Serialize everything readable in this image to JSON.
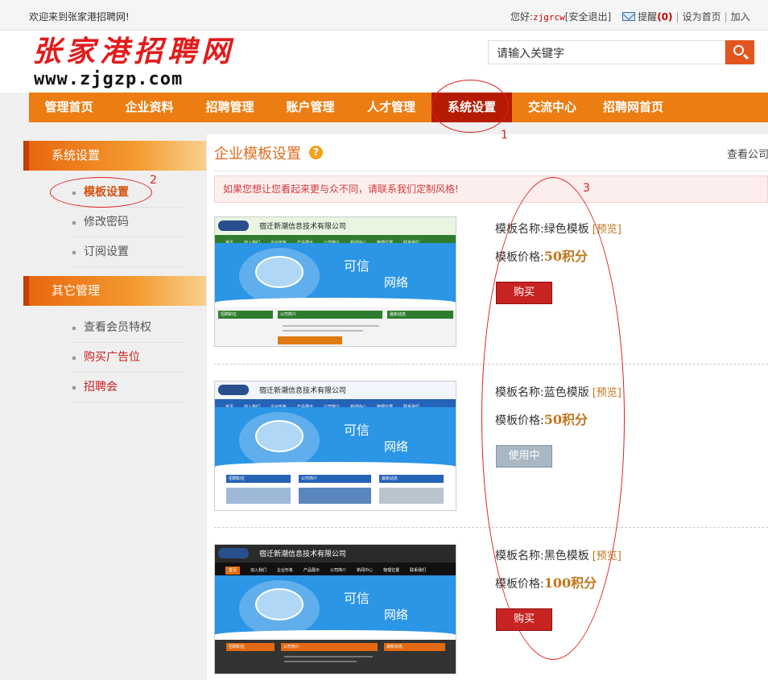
{
  "topbar": {
    "welcome": "欢迎来到张家港招聘网!",
    "greeting": "您好:",
    "username": "zjgrcw",
    "logout": "[安全退出]",
    "remind": "提醒",
    "remind_count": "(0)",
    "set_home": "设为首页",
    "add_fav": "加入"
  },
  "header": {
    "logo_cn": "张家港招聘网",
    "logo_url": "www.zjgzp.com",
    "search_placeholder": "请输入关键字"
  },
  "nav": [
    {
      "label": "管理首页"
    },
    {
      "label": "企业资料"
    },
    {
      "label": "招聘管理"
    },
    {
      "label": "账户管理"
    },
    {
      "label": "人才管理"
    },
    {
      "label": "系统设置",
      "active": true
    },
    {
      "label": "交流中心"
    },
    {
      "label": "招聘网首页"
    }
  ],
  "sidebar": {
    "group1": "系统设置",
    "items1": [
      "模板设置",
      "修改密码",
      "订阅设置"
    ],
    "group2": "其它管理",
    "items2": [
      "查看会员特权",
      "购买广告位",
      "招聘会"
    ]
  },
  "main": {
    "title": "企业模板设置",
    "help": "?",
    "view_link": "查看公司",
    "notice": "如果您想让您看起来更与众不同，请联系我们定制风格!",
    "name_label": "模板名称:",
    "price_label": "模板价格:",
    "preview": "[预览]",
    "templates": [
      {
        "name": "绿色模板",
        "price": "50积分",
        "button": "购买",
        "button_type": "buy"
      },
      {
        "name": "蓝色模版",
        "price": "50积分",
        "button": "使用中",
        "button_type": "using"
      },
      {
        "name": "黑色模板",
        "price": "100积分",
        "button": "购买",
        "button_type": "buy"
      }
    ],
    "thumb": {
      "company": "宿迁新潮信息技术有限公司",
      "nav": [
        "首页",
        "加入我们",
        "企业形象",
        "产品展示",
        "公司简介",
        "新闻中心",
        "物理位置",
        "联系我们"
      ],
      "slogan1": "可信",
      "slogan2": "网络",
      "box1": "招聘职位",
      "box2": "公司简介",
      "box3": "最新动态"
    }
  },
  "annotations": [
    "1",
    "2",
    "3"
  ],
  "colors": {
    "nav_bg": "#ec7d12",
    "nav_active": "#b51b00",
    "accent": "#e06c1f",
    "buy_button": "#c82323",
    "using_button": "#a9b7c3"
  }
}
